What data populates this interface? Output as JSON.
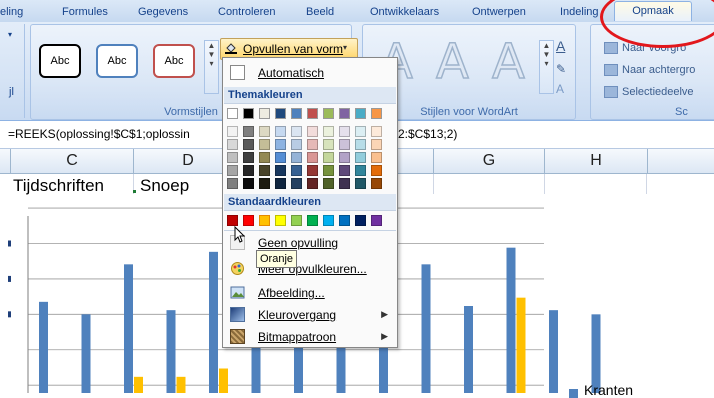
{
  "ribbon": {
    "tabs": [
      "eling",
      "Formules",
      "Gegevens",
      "Controleren",
      "Beeld",
      "Ontwikkelaars",
      "Ontwerpen",
      "Indeling",
      "Opmaak"
    ],
    "active_tab": "Opmaak",
    "highlight_color": "#e2171c",
    "left_fragment": "jl",
    "groups": {
      "shape_styles": "Vormstijlen",
      "wordart_styles": "Stijlen voor WordArt",
      "arrange": "Sc"
    },
    "shape_style_swatches": [
      "Abc",
      "Abc",
      "Abc"
    ],
    "shape_style_border_colors": [
      "#000000",
      "#4f81bd",
      "#c0504d"
    ],
    "wordart_letters": [
      "A",
      "A",
      "A"
    ],
    "arrange_buttons": [
      "Naar voorgro",
      "Naar achtergro",
      "Selectiedeelve"
    ],
    "fill_button": "Opvullen van vorm"
  },
  "formula_bar": {
    "left_text": "=REEKS(oplossing!$C$1;oplossin",
    "right_text": "2:$C$13;2)"
  },
  "sheet": {
    "columns": [
      "C",
      "D",
      "",
      "G",
      "H"
    ],
    "cells": [
      "Tijdschriften",
      "Snoep"
    ]
  },
  "chart_data": {
    "type": "bar",
    "categories": [],
    "series": [
      {
        "name": "Kranten",
        "color": "#4f81bd",
        "values": [
          3.7,
          3.4,
          4.6,
          3.5,
          4.9,
          4.0,
          4.4,
          4.1,
          4.6,
          4.6,
          3.6,
          5.0,
          3.5,
          3.4
        ]
      },
      {
        "name": "",
        "color": "#ffc000",
        "values": [
          1.3,
          null,
          1.9,
          1.9,
          2.1,
          1.4,
          null,
          null,
          null,
          null,
          null,
          3.8,
          1.4,
          null
        ]
      }
    ],
    "ylim": [
      0,
      6
    ],
    "legend": "bottom-right",
    "grid": true
  },
  "fill_menu": {
    "automatic": "Automatisch",
    "theme_colors_title": "Themakleuren",
    "standard_colors_title": "Standaardkleuren",
    "theme_top_row": [
      "#ffffff",
      "#000000",
      "#eeece1",
      "#1f497d",
      "#4f81bd",
      "#c0504d",
      "#9bbb59",
      "#8064a2",
      "#4bacc6",
      "#f79646"
    ],
    "theme_shades": [
      [
        "#f2f2f2",
        "#7f7f7f",
        "#ddd9c3",
        "#c6d9f0",
        "#dbe5f1",
        "#f2dcdb",
        "#ebf1dd",
        "#e5e0ec",
        "#dbeef3",
        "#fdeada"
      ],
      [
        "#d8d8d8",
        "#595959",
        "#c4bd97",
        "#8db3e2",
        "#b8cce4",
        "#e5b9b7",
        "#d7e3bc",
        "#ccc1d9",
        "#b7dde8",
        "#fbd5b5"
      ],
      [
        "#bfbfbf",
        "#3f3f3f",
        "#938953",
        "#548dd4",
        "#95b3d7",
        "#d99694",
        "#c3d69b",
        "#b2a2c7",
        "#92cddc",
        "#fac08f"
      ],
      [
        "#a5a5a5",
        "#262626",
        "#494429",
        "#17365d",
        "#366092",
        "#953734",
        "#76923c",
        "#5f497a",
        "#31859b",
        "#e36c09"
      ],
      [
        "#7f7f7f",
        "#0c0c0c",
        "#1d1b10",
        "#0f243e",
        "#244061",
        "#632423",
        "#4f6128",
        "#3f3151",
        "#205867",
        "#974806"
      ]
    ],
    "standard_colors": [
      "#c00000",
      "#ff0000",
      "#ffc000",
      "#ffff00",
      "#92d050",
      "#00b050",
      "#00b0f0",
      "#0070c0",
      "#002060",
      "#7030a0"
    ],
    "no_fill": "Geen opvulling",
    "tooltip": "Oranje",
    "more_colors": "Meer opvulkleuren...",
    "picture": "Afbeelding...",
    "gradient": "Kleurovergang",
    "texture": "Bitmappatroon"
  }
}
